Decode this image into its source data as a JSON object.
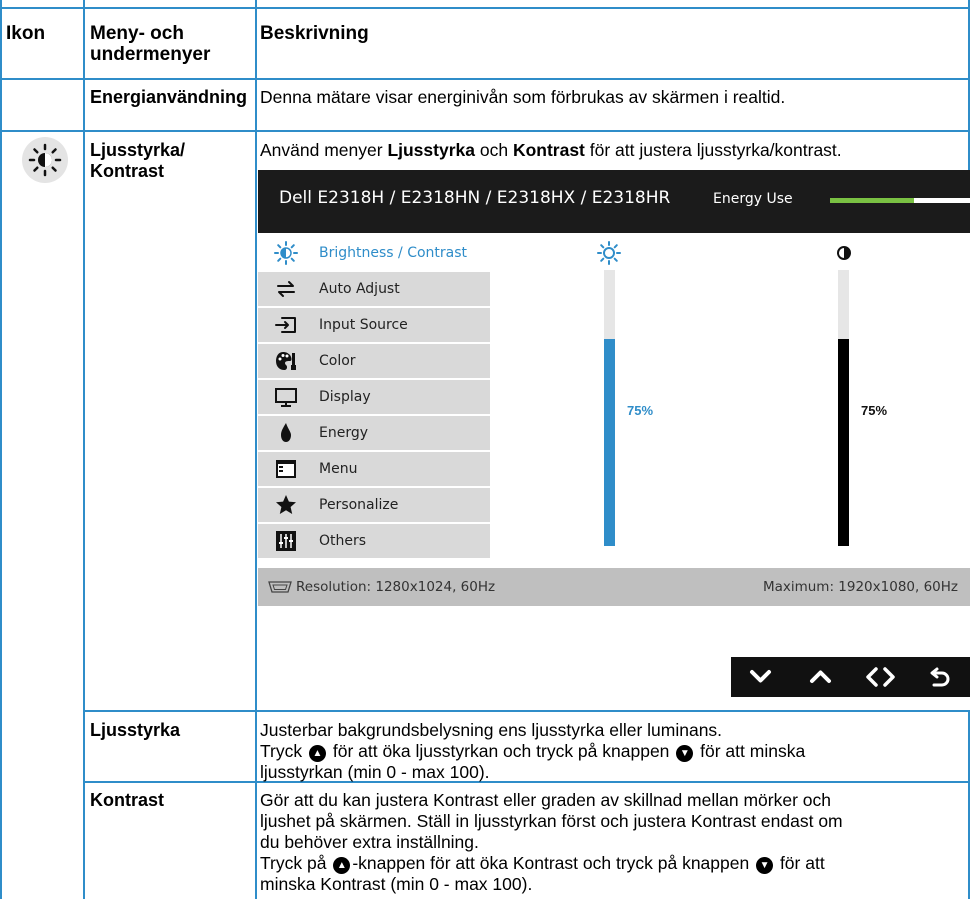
{
  "table": {
    "headers": {
      "icon": "Ikon",
      "menu": "Meny- och undermenyer",
      "desc": "Beskrivning"
    },
    "rows": {
      "energy": {
        "name": "Energianvändning",
        "desc": "Denna mätare visar energinivån som förbrukas av skärmen i realtid."
      },
      "brightness_contrast": {
        "name": "Ljusstyrka/ Kontrast",
        "desc_pre": "Använd menyer ",
        "desc_b1": "Ljusstyrka",
        "desc_mid": " och ",
        "desc_b2": "Kontrast",
        "desc_post": " för att justera ljusstyrka/kontrast."
      },
      "brightness": {
        "name": "Ljusstyrka",
        "line1": "Justerbar bakgrundsbelysning ens ljusstyrka eller luminans.",
        "line2_a": "Tryck ",
        "line2_b": " för att öka ljusstyrkan och tryck på knappen ",
        "line2_c": " för att minska",
        "line3": "ljusstyrkan (min 0 - max 100)."
      },
      "contrast": {
        "name": "Kontrast",
        "line1": "Gör att du kan justera Kontrast eller graden av skillnad mellan mörker och",
        "line2": "ljushet på skärmen. Ställ in ljusstyrkan först och justera Kontrast endast om",
        "line3": "du behöver extra inställning.",
        "line4_a": "Tryck på ",
        "line4_b": "-knappen för att öka Kontrast och tryck på knappen ",
        "line4_c": " för att",
        "line5": "minska Kontrast (min 0 - max 100)."
      }
    }
  },
  "osd": {
    "title": "Dell E2318H / E2318HN / E2318HX / E2318HR",
    "energy_label": "Energy Use",
    "energy_level": 0.6,
    "menu": [
      {
        "label": "Brightness / Contrast",
        "icon": "brightness-icon",
        "selected": true
      },
      {
        "label": "Auto Adjust",
        "icon": "auto-adjust-icon"
      },
      {
        "label": "Input Source",
        "icon": "input-source-icon"
      },
      {
        "label": "Color",
        "icon": "color-icon"
      },
      {
        "label": "Display",
        "icon": "display-icon"
      },
      {
        "label": "Energy",
        "icon": "energy-icon"
      },
      {
        "label": "Menu",
        "icon": "menu-icon"
      },
      {
        "label": "Personalize",
        "icon": "personalize-icon"
      },
      {
        "label": "Others",
        "icon": "others-icon"
      }
    ],
    "brightness": {
      "value": 75,
      "label": "75%",
      "color": "#2f8dc9"
    },
    "contrast": {
      "value": 75,
      "label": "75%",
      "color": "#000000"
    },
    "resolution": "Resolution: 1280x1024, 60Hz",
    "maximum": "Maximum: 1920x1080, 60Hz",
    "nav_buttons": [
      "down-icon",
      "up-icon",
      "enter-icon",
      "back-icon"
    ]
  },
  "colors": {
    "rule": "#2f8dc9",
    "accent": "#2f8dc9",
    "energy_green": "#7ac143"
  }
}
